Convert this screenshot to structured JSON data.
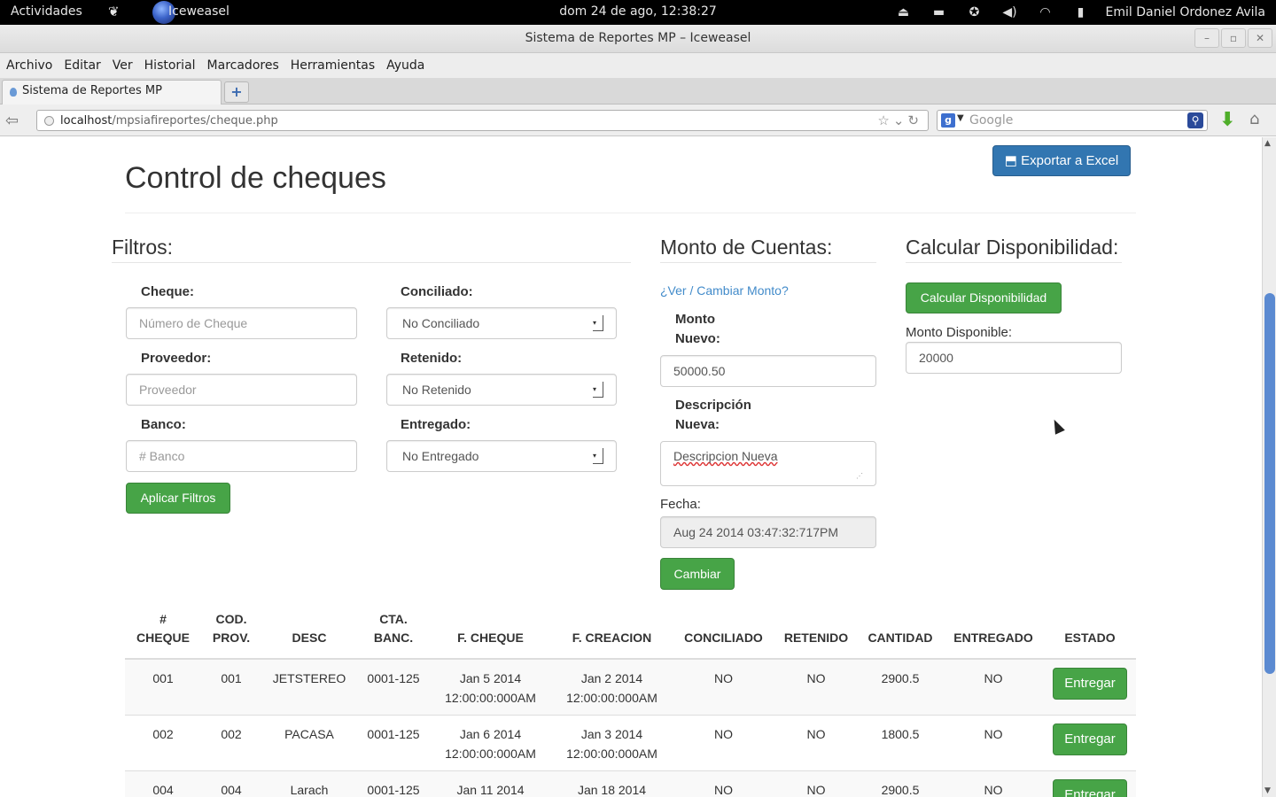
{
  "system_bar": {
    "activities": "Actividades",
    "app_name": "Iceweasel",
    "clock": "dom 24 de ago, 12:38:27",
    "user": "Emil Daniel Ordonez Avila"
  },
  "window": {
    "title": "Sistema de Reportes MP – Iceweasel"
  },
  "menu": [
    "Archivo",
    "Editar",
    "Ver",
    "Historial",
    "Marcadores",
    "Herramientas",
    "Ayuda"
  ],
  "tab": {
    "label": "Sistema de Reportes MP"
  },
  "address": {
    "host": "localhost",
    "path": "/mpsiafireportes/cheque.php"
  },
  "search": {
    "placeholder": "Google"
  },
  "page": {
    "export_label": "Exportar a Excel",
    "title": "Control de cheques",
    "filters": {
      "title": "Filtros:",
      "cheque_label": "Cheque:",
      "cheque_placeholder": "Número de Cheque",
      "proveedor_label": "Proveedor:",
      "proveedor_placeholder": "Proveedor",
      "banco_label": "Banco:",
      "banco_placeholder": "# Banco",
      "conciliado_label": "Conciliado:",
      "conciliado_value": "No Conciliado",
      "retenido_label": "Retenido:",
      "retenido_value": "No Retenido",
      "entregado_label": "Entregado:",
      "entregado_value": "No Entregado",
      "apply_label": "Aplicar Filtros"
    },
    "monto": {
      "title": "Monto de Cuentas:",
      "link": "¿Ver / Cambiar Monto?",
      "nuevo_label_1": "Monto",
      "nuevo_label_2": "Nuevo:",
      "nuevo_value": "50000.50",
      "desc_label_1": "Descripción",
      "desc_label_2": "Nueva:",
      "desc_value": "Descripcion Nueva",
      "fecha_label": "Fecha:",
      "fecha_value": "Aug 24 2014 03:47:32:717PM",
      "change_label": "Cambiar"
    },
    "disponibilidad": {
      "title": "Calcular Disponibilidad:",
      "button_label": "Calcular Disponibilidad",
      "available_label": "Monto Disponible:",
      "available_value": "20000"
    },
    "table": {
      "headers": [
        [
          "#",
          "CHEQUE"
        ],
        [
          "COD.",
          "PROV."
        ],
        [
          "",
          "DESC"
        ],
        [
          "CTA.",
          "BANC."
        ],
        [
          "",
          "F. CHEQUE"
        ],
        [
          "",
          "F. CREACION"
        ],
        [
          "",
          "CONCILIADO"
        ],
        [
          "",
          "RETENIDO"
        ],
        [
          "",
          "CANTIDAD"
        ],
        [
          "",
          "ENTREGADO"
        ],
        [
          "",
          "ESTADO"
        ]
      ],
      "action_label": "Entregar",
      "rows": [
        {
          "cheque": "001",
          "prov": "001",
          "desc": "JETSTEREO",
          "cta": "0001-125",
          "f_cheque_1": "Jan 5 2014",
          "f_cheque_2": "12:00:00:000AM",
          "f_creacion_1": "Jan 2 2014",
          "f_creacion_2": "12:00:00:000AM",
          "conciliado": "NO",
          "retenido": "NO",
          "cantidad": "2900.5",
          "entregado": "NO"
        },
        {
          "cheque": "002",
          "prov": "002",
          "desc": "PACASA",
          "cta": "0001-125",
          "f_cheque_1": "Jan 6 2014",
          "f_cheque_2": "12:00:00:000AM",
          "f_creacion_1": "Jan 3 2014",
          "f_creacion_2": "12:00:00:000AM",
          "conciliado": "NO",
          "retenido": "NO",
          "cantidad": "1800.5",
          "entregado": "NO"
        },
        {
          "cheque": "004",
          "prov": "004",
          "desc": "Larach",
          "cta": "0001-125",
          "f_cheque_1": "Jan 11 2014",
          "f_cheque_2": "",
          "f_creacion_1": "Jan 18 2014",
          "f_creacion_2": "",
          "conciliado": "NO",
          "retenido": "NO",
          "cantidad": "2900.5",
          "entregado": "NO"
        }
      ]
    }
  },
  "colors": {
    "success": "#47a447",
    "primary": "#3276b1",
    "link": "#428bca"
  }
}
